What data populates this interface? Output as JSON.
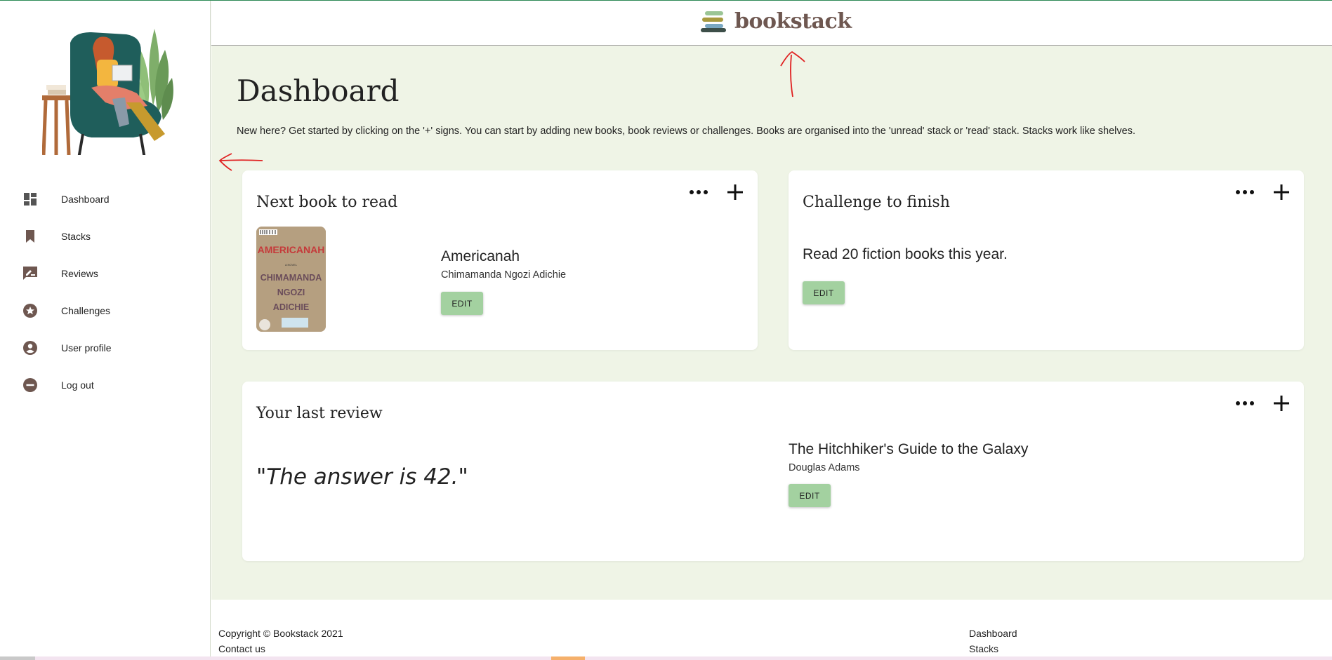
{
  "app": {
    "name": "bookstack",
    "brand_color": "#6e5750",
    "accent_color": "#a3d1a0",
    "background_color": "#eff4e6"
  },
  "sidebar": {
    "items": [
      {
        "label": "Dashboard",
        "icon": "dashboard-icon"
      },
      {
        "label": "Stacks",
        "icon": "bookmark-icon"
      },
      {
        "label": "Reviews",
        "icon": "rate-review-icon"
      },
      {
        "label": "Challenges",
        "icon": "star-badge-icon"
      },
      {
        "label": "User profile",
        "icon": "account-circle-icon"
      },
      {
        "label": "Log out",
        "icon": "minus-circle-icon"
      }
    ]
  },
  "main": {
    "title": "Dashboard",
    "intro": "New here? Get started by clicking on the '+' signs. You can start by adding new books, book reviews or challenges. Books are organised into the 'unread' stack or 'read' stack. Stacks work like shelves.",
    "next_book": {
      "heading": "Next book to read",
      "title": "Americanah",
      "author": "Chimamanda Ngozi Adichie",
      "edit_label": "EDIT",
      "cover": {
        "line1": "AMERICANAH",
        "line2": "A NOVEL",
        "line3": "CHIMAMANDA",
        "line4": "NGOZI",
        "line5": "ADICHIE"
      }
    },
    "challenge": {
      "heading": "Challenge to finish",
      "text": "Read 20 fiction books this year.",
      "edit_label": "EDIT"
    },
    "review": {
      "heading": "Your last review",
      "quote": "\"The answer is 42.\"",
      "book_title": "The Hitchhiker's Guide to the Galaxy",
      "author": "Douglas Adams",
      "edit_label": "EDIT"
    }
  },
  "footer": {
    "copyright": "Copyright © Bookstack 2021",
    "contact": "Contact us",
    "links": [
      "Dashboard",
      "Stacks"
    ]
  }
}
